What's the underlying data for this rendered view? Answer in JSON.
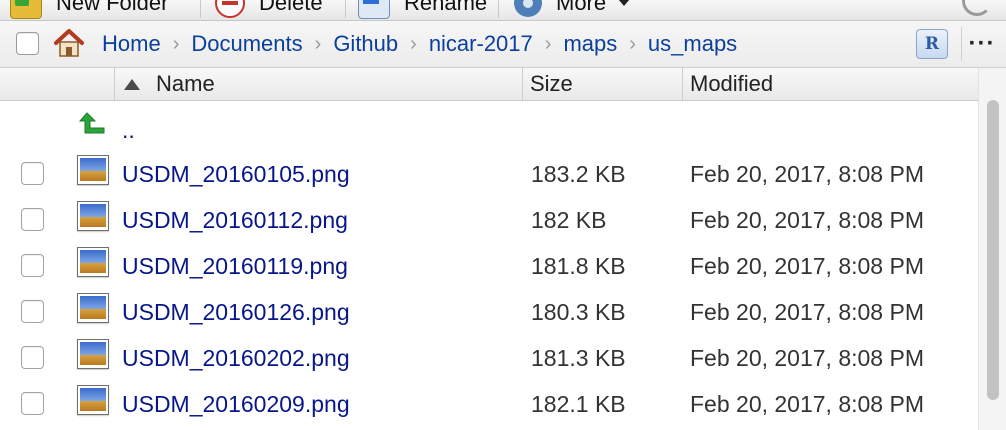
{
  "toolbar": {
    "new_folder": "New Folder",
    "delete": "Delete",
    "rename": "Rename",
    "more": "More"
  },
  "breadcrumb": {
    "items": [
      "Home",
      "Documents",
      "Github",
      "nicar-2017",
      "maps",
      "us_maps"
    ],
    "separator": "›",
    "r_icon": "R",
    "ellipsis": "···"
  },
  "columns": {
    "name": "Name",
    "size": "Size",
    "modified": "Modified"
  },
  "parent_dir": "..",
  "files": [
    {
      "name": "USDM_20160105.png",
      "size": "183.2 KB",
      "modified": "Feb 20, 2017, 8:08 PM"
    },
    {
      "name": "USDM_20160112.png",
      "size": "182 KB",
      "modified": "Feb 20, 2017, 8:08 PM"
    },
    {
      "name": "USDM_20160119.png",
      "size": "181.8 KB",
      "modified": "Feb 20, 2017, 8:08 PM"
    },
    {
      "name": "USDM_20160126.png",
      "size": "180.3 KB",
      "modified": "Feb 20, 2017, 8:08 PM"
    },
    {
      "name": "USDM_20160202.png",
      "size": "181.3 KB",
      "modified": "Feb 20, 2017, 8:08 PM"
    },
    {
      "name": "USDM_20160209.png",
      "size": "182.1 KB",
      "modified": "Feb 20, 2017, 8:08 PM"
    }
  ],
  "colors": {
    "link": "#07178a",
    "breadcrumb_link": "#0b3f9c",
    "up_arrow": "#2aa33b"
  }
}
